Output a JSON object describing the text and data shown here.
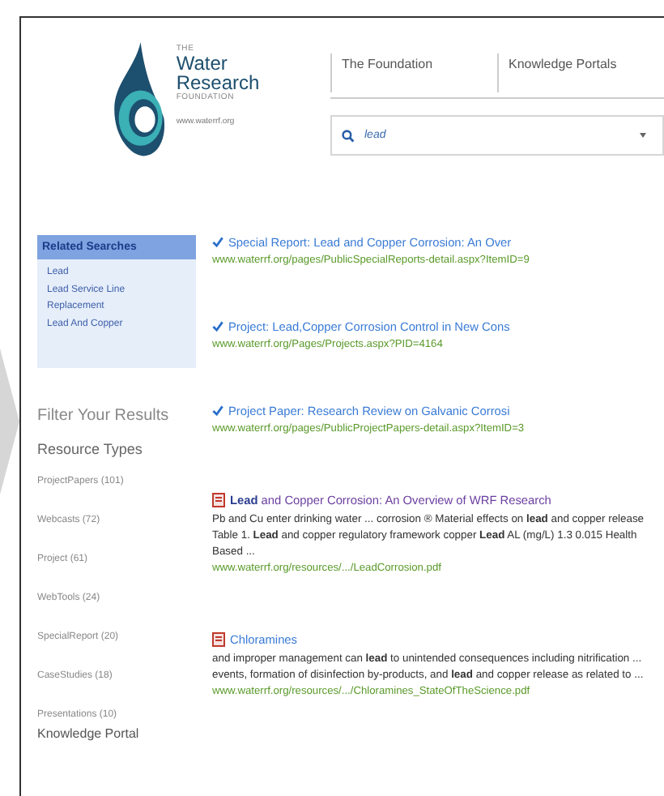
{
  "logo": {
    "the": "THE",
    "line1": "Water",
    "line2": "Research",
    "foundation": "FOUNDATION",
    "url": "www.waterrf.org"
  },
  "nav": [
    {
      "label": "The Foundation"
    },
    {
      "label": "Knowledge Portals"
    }
  ],
  "search": {
    "value": "lead"
  },
  "related": {
    "title": "Related Searches",
    "items": [
      "Lead",
      "Lead Service Line Replacement",
      "Lead And Copper"
    ]
  },
  "filter": {
    "title": "Filter Your Results",
    "section": "Resource Types",
    "items": [
      "ProjectPapers (101)",
      "Webcasts (72)",
      "Project (61)",
      "WebTools (24)",
      "SpecialReport (20)",
      "CaseStudies (18)",
      "Presentations (10)"
    ]
  },
  "results": [
    {
      "kind": "check",
      "title": "Special Report: Lead and Copper Corrosion: An Over",
      "url": "www.waterrf.org/pages/PublicSpecialReports-detail.aspx?ItemID=9",
      "visited": false
    },
    {
      "kind": "check",
      "title": "Project: Lead,Copper Corrosion Control in New Cons",
      "url": "www.waterrf.org/Pages/Projects.aspx?PID=4164",
      "visited": false
    },
    {
      "kind": "check",
      "title": "Project Paper: Research Review on Galvanic Corrosi",
      "url": "www.waterrf.org/pages/PublicProjectPapers-detail.aspx?ItemID=3",
      "visited": false
    },
    {
      "kind": "pdf",
      "title": "**Lead** and Copper Corrosion: An Overview of WRF Research",
      "snippet": "Pb and Cu enter drinking water ... corrosion ® Material effects on **lead** and copper release Table 1. **Lead** and copper regulatory framework copper **Lead** AL (mg/L) 1.3 0.015 Health Based ...",
      "url": "www.waterrf.org/resources/.../LeadCorrosion.pdf",
      "visited": true
    },
    {
      "kind": "pdf",
      "title": "Chloramines",
      "snippet": "and improper management can **lead** to unintended consequences including nitrification ... events, formation of disinfection by-products, and **lead** and copper release as related to ...",
      "url": "www.waterrf.org/resources/.../Chloramines_StateOfTheScience.pdf",
      "visited": false
    }
  ],
  "footer_heading": "Knowledge Portal"
}
